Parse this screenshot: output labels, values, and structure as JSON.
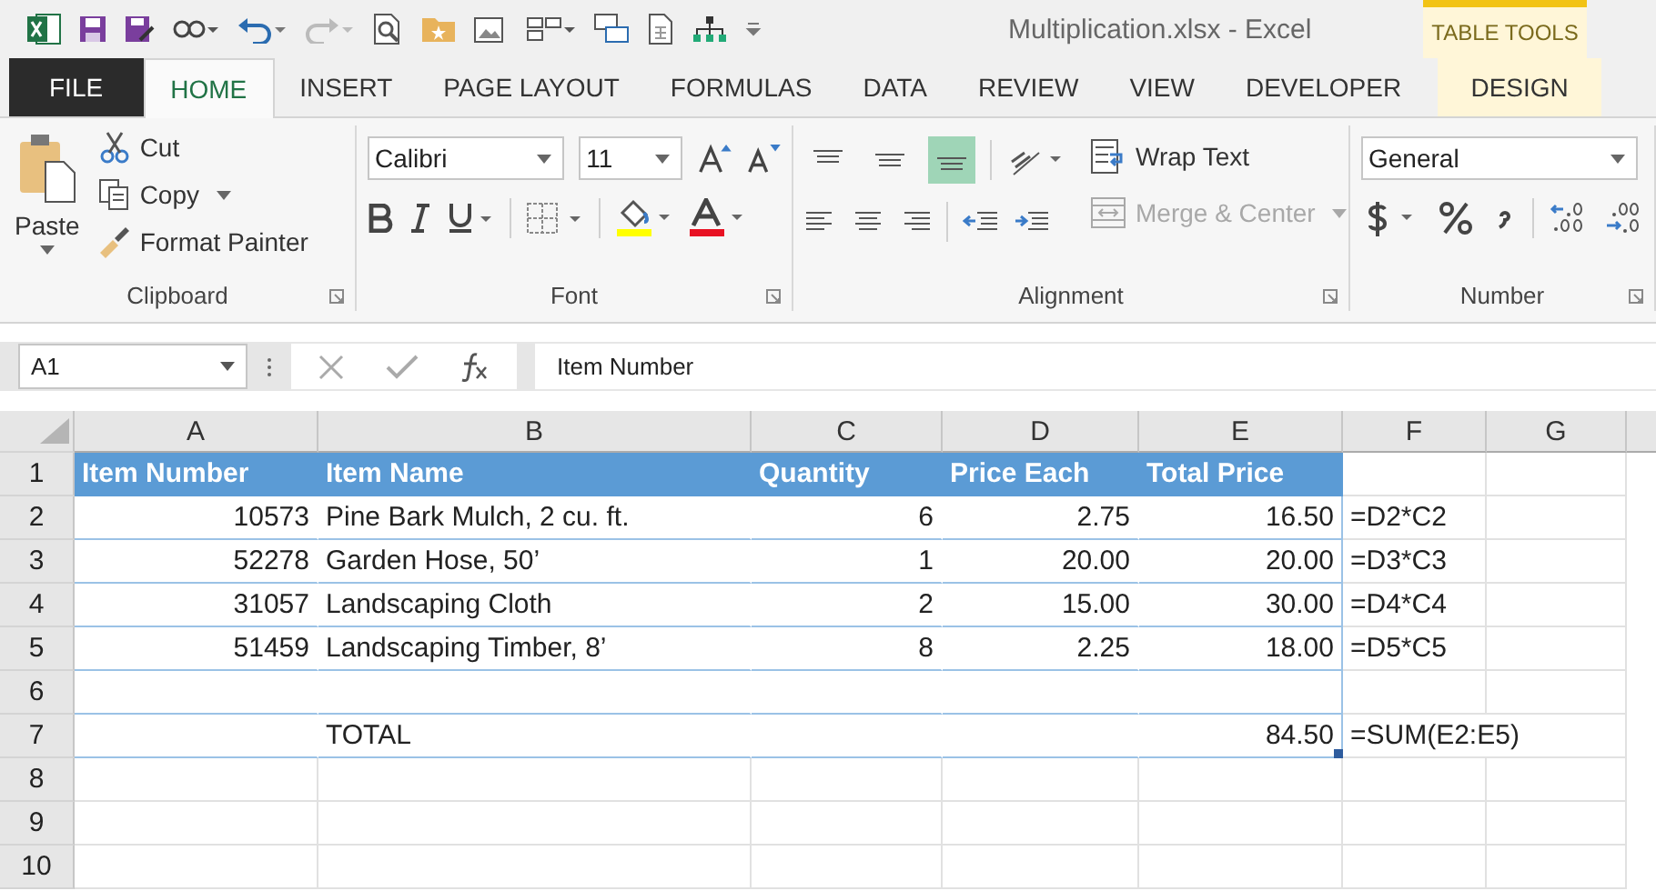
{
  "window": {
    "title": "Multiplication.xlsx - Excel",
    "context_label": "TABLE TOOLS"
  },
  "tabs": [
    {
      "label": "FILE",
      "kind": "file",
      "selected": false
    },
    {
      "label": "HOME",
      "kind": "normal",
      "selected": true
    },
    {
      "label": "INSERT",
      "kind": "normal",
      "selected": false
    },
    {
      "label": "PAGE LAYOUT",
      "kind": "normal",
      "selected": false
    },
    {
      "label": "FORMULAS",
      "kind": "normal",
      "selected": false
    },
    {
      "label": "DATA",
      "kind": "normal",
      "selected": false
    },
    {
      "label": "REVIEW",
      "kind": "normal",
      "selected": false
    },
    {
      "label": "VIEW",
      "kind": "normal",
      "selected": false
    },
    {
      "label": "DEVELOPER",
      "kind": "normal",
      "selected": false
    },
    {
      "label": "DESIGN",
      "kind": "contextual",
      "selected": false
    }
  ],
  "ribbon": {
    "clipboard": {
      "label": "Clipboard",
      "paste": "Paste",
      "cut": "Cut",
      "copy": "Copy",
      "format_painter": "Format Painter"
    },
    "font": {
      "label": "Font",
      "font_name": "Calibri",
      "font_size": "11"
    },
    "alignment": {
      "label": "Alignment",
      "vertical_align": [
        {
          "selected": false
        },
        {
          "selected": false
        },
        {
          "selected": true
        }
      ],
      "wrap_text": "Wrap Text",
      "merge_center": "Merge & Center",
      "merge_disabled": true
    },
    "number": {
      "label": "Number",
      "format": "General"
    }
  },
  "formula_bar": {
    "name_box": "A1",
    "formula": "Item Number"
  },
  "sheet": {
    "columns": [
      "A",
      "B",
      "C",
      "D",
      "E",
      "F",
      "G"
    ],
    "rows": [
      {
        "number": "1",
        "kind": "header",
        "cells": {
          "A": "Item Number",
          "B": "Item Name",
          "C": "Quantity",
          "D": "Price Each",
          "E": "Total Price"
        }
      },
      {
        "number": "2",
        "kind": "data",
        "cells": {
          "A": "10573",
          "B": "Pine Bark Mulch, 2 cu. ft.",
          "C": "6",
          "D": "2.75",
          "E": "16.50",
          "F": "=D2*C2"
        }
      },
      {
        "number": "3",
        "kind": "data",
        "cells": {
          "A": "52278",
          "B": "Garden Hose, 50’",
          "C": "1",
          "D": "20.00",
          "E": "20.00",
          "F": "=D3*C3"
        }
      },
      {
        "number": "4",
        "kind": "data",
        "cells": {
          "A": "31057",
          "B": "Landscaping Cloth",
          "C": "2",
          "D": "15.00",
          "E": "30.00",
          "F": "=D4*C4"
        }
      },
      {
        "number": "5",
        "kind": "data",
        "cells": {
          "A": "51459",
          "B": "Landscaping Timber, 8’",
          "C": "8",
          "D": "2.25",
          "E": "18.00",
          "F": "=D5*C5"
        }
      },
      {
        "number": "6",
        "kind": "data",
        "cells": {}
      },
      {
        "number": "7",
        "kind": "total",
        "cells": {
          "B": "TOTAL",
          "E": "84.50",
          "F": "=SUM(E2:E5)"
        }
      },
      {
        "number": "8",
        "kind": "plain",
        "cells": {}
      },
      {
        "number": "9",
        "kind": "plain",
        "cells": {}
      },
      {
        "number": "10",
        "kind": "plain",
        "cells": {}
      }
    ]
  }
}
